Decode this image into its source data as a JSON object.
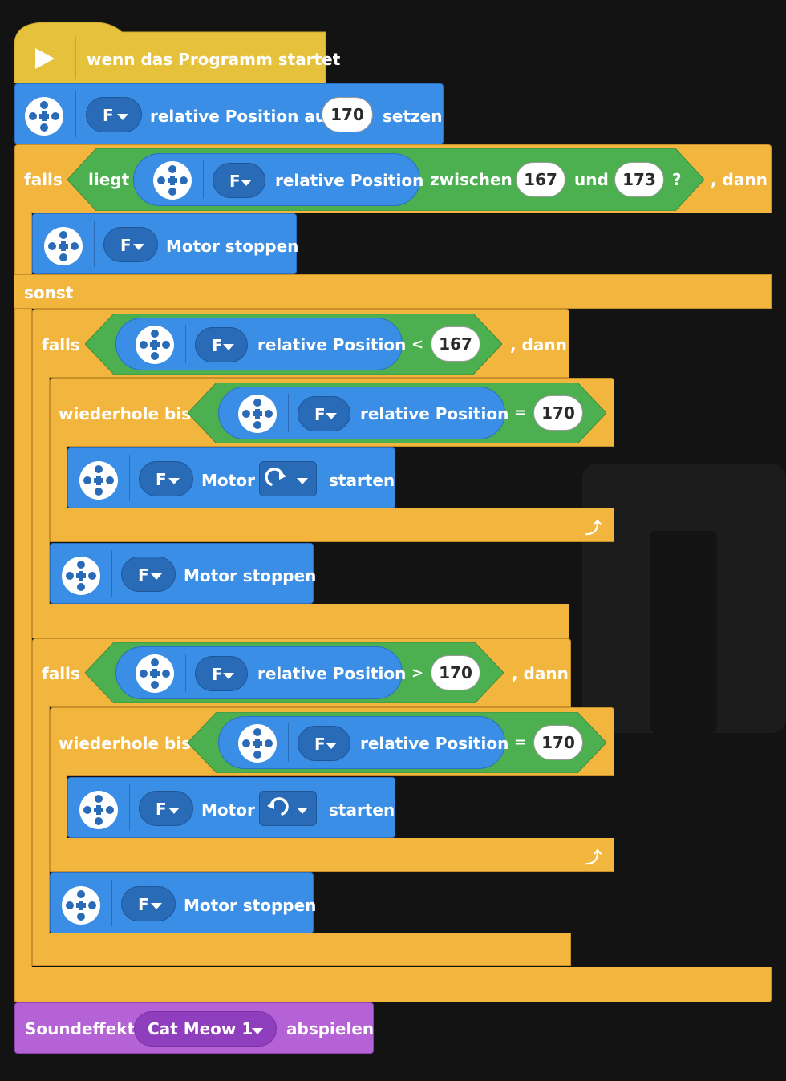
{
  "hat": {
    "label": "wenn das Programm startet"
  },
  "set_pos": {
    "port": "F",
    "pre": "relative Position auf",
    "value": "170",
    "post": "setzen"
  },
  "if1": {
    "falls": "falls",
    "liegt": "liegt",
    "port": "F",
    "reporter": "relative Position",
    "zwischen": "zwischen",
    "low": "167",
    "und": "und",
    "high": "173",
    "q": "?",
    "dann": ", dann"
  },
  "stop1": {
    "port": "F",
    "label": "Motor stoppen"
  },
  "sonst": "sonst",
  "if2": {
    "falls": "falls",
    "port": "F",
    "reporter": "relative Position",
    "op": "<",
    "value": "167",
    "dann": ", dann"
  },
  "rep1": {
    "label": "wiederhole bis",
    "port": "F",
    "reporter": "relative Position",
    "op": "=",
    "value": "170"
  },
  "start1": {
    "port": "F",
    "motor": "Motor",
    "post": "starten",
    "direction_icon": "clockwise-icon"
  },
  "stop2": {
    "port": "F",
    "label": "Motor stoppen"
  },
  "if3": {
    "falls": "falls",
    "port": "F",
    "reporter": "relative Position",
    "op": ">",
    "value": "170",
    "dann": ", dann"
  },
  "rep2": {
    "label": "wiederhole bis",
    "port": "F",
    "reporter": "relative Position",
    "op": "=",
    "value": "170"
  },
  "start2": {
    "port": "F",
    "motor": "Motor",
    "post": "starten",
    "direction_icon": "counterclockwise-icon"
  },
  "stop3": {
    "port": "F",
    "label": "Motor stoppen"
  },
  "sound": {
    "pre": "Soundeffekt",
    "value": "Cat Meow 1",
    "post": "abspielen"
  },
  "colors": {
    "background": "#131313",
    "event": "#e6c23c",
    "control": "#f2b63f",
    "motor": "#3a8ee6",
    "operator": "#4caf50",
    "sound": "#b462d6"
  }
}
